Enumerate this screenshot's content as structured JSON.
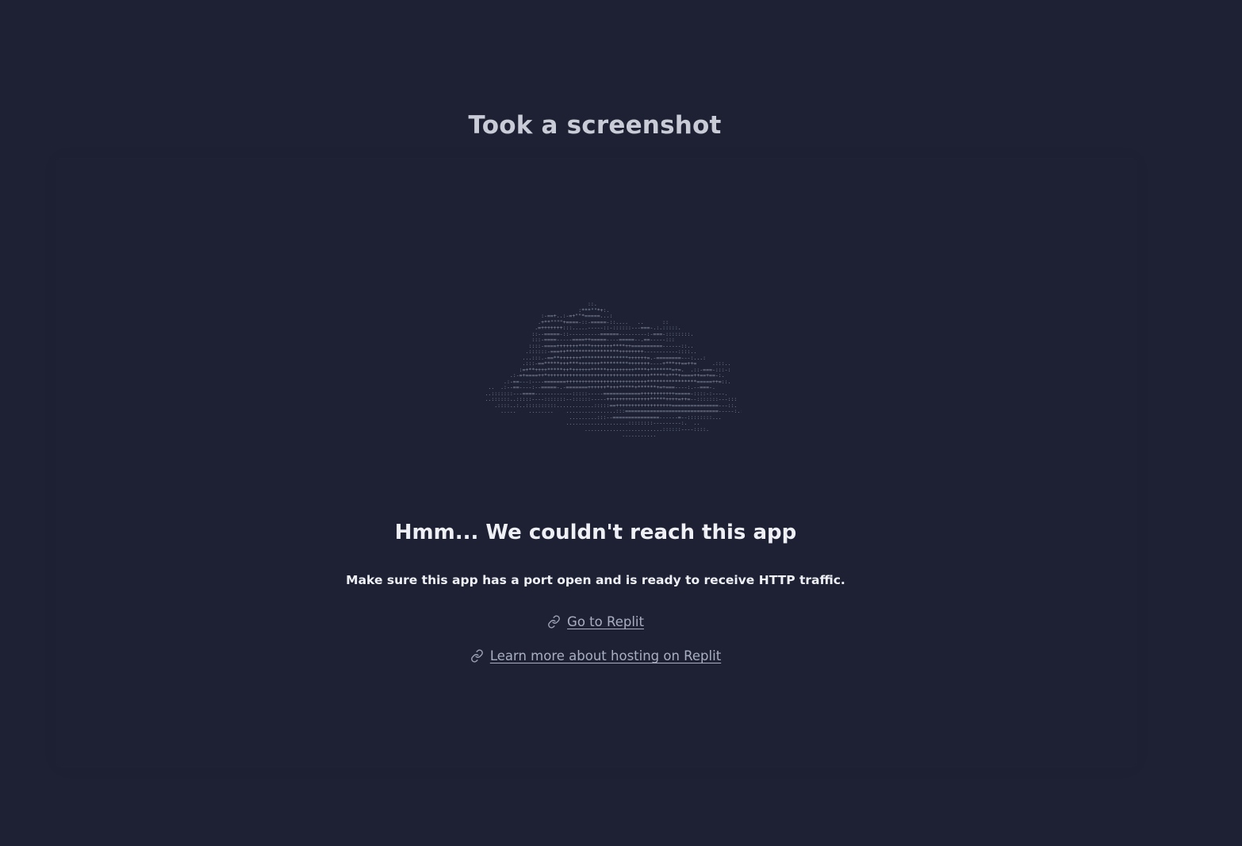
{
  "caption": "Took a screenshot",
  "error": {
    "title": "Hmm... We couldn't reach this app",
    "message": "Make sure this app has a port open and is ready to receive HTTP traffic."
  },
  "links": [
    {
      "label": "Go to Replit",
      "icon": "link-icon"
    },
    {
      "label": "Learn more about hosting on Replit",
      "icon": "link-icon"
    }
  ],
  "colors": {
    "background": "#1d2133",
    "heading": "#eef0f5",
    "link": "#a9aec0",
    "ascii_art": "#8a90a6"
  }
}
